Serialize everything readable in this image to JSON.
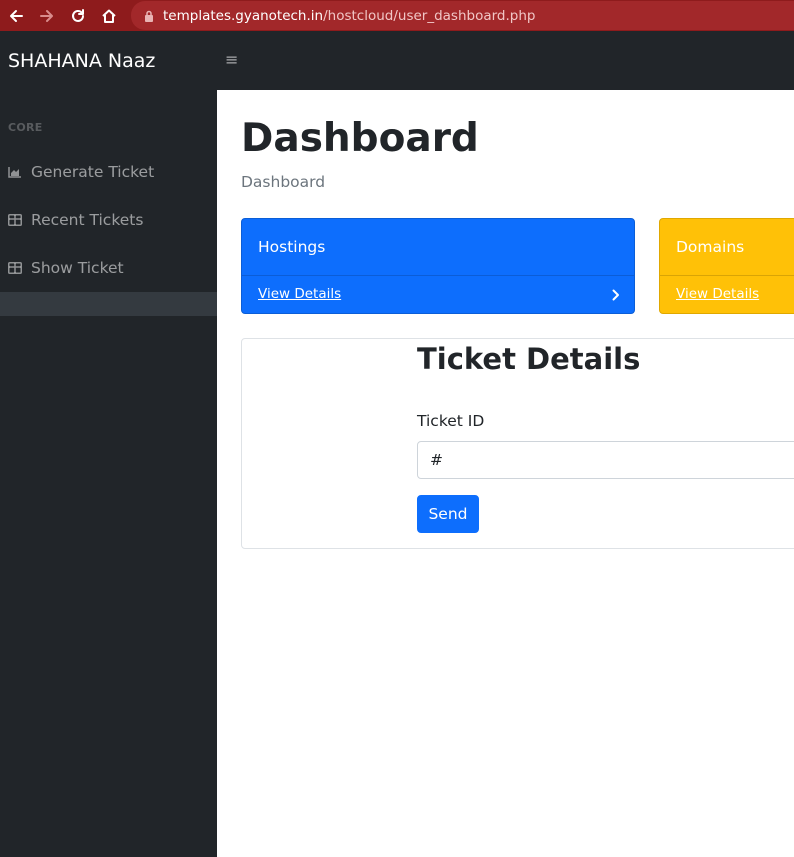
{
  "browser": {
    "url_host": "templates.gyanotech.in",
    "url_path": "/hostcloud/user_dashboard.php"
  },
  "navbar": {
    "brand": "SHAHANA Naaz",
    "toggle_icon": "≡"
  },
  "sidebar": {
    "heading": "CORE",
    "items": [
      {
        "label": "Generate Ticket",
        "icon": "chart-area-icon"
      },
      {
        "label": "Recent Tickets",
        "icon": "table-icon"
      },
      {
        "label": "Show Ticket",
        "icon": "table-icon"
      }
    ]
  },
  "main": {
    "title": "Dashboard",
    "breadcrumb": "Dashboard",
    "cards": [
      {
        "title": "Hostings",
        "link": "View Details",
        "color": "#0d6efd"
      },
      {
        "title": "Domains",
        "link": "View Details",
        "color": "#ffc107"
      }
    ],
    "ticket_form": {
      "title": "Ticket Details",
      "label": "Ticket ID",
      "value": "#",
      "button": "Send"
    }
  },
  "colors": {
    "browser_bar": "#8e1b1c",
    "dark": "#212529",
    "primary": "#0d6efd",
    "warning": "#ffc107"
  }
}
